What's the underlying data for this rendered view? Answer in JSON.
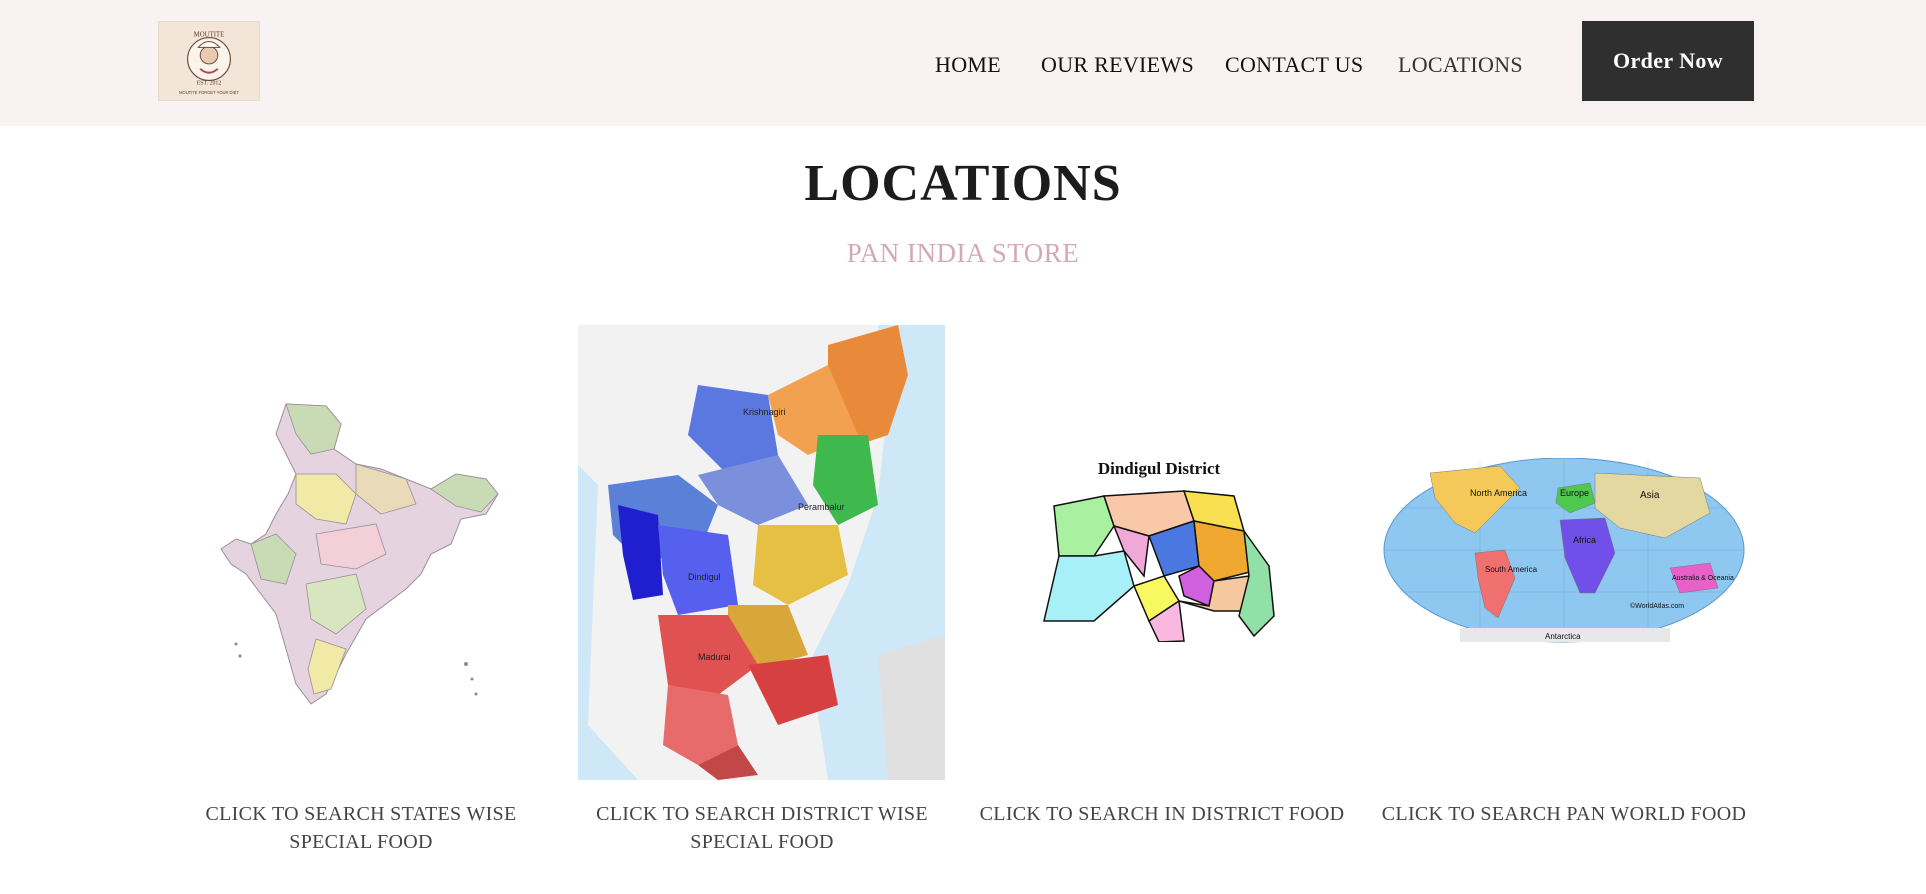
{
  "header": {
    "logo": {
      "lines": [
        "MOUTITE",
        "EST. 2012",
        "MOUTITE FORGET YOUR DIET"
      ]
    },
    "nav": [
      "HOME",
      "OUR REVIEWS",
      "CONTACT US",
      "LOCATIONS"
    ],
    "order_button": "Order Now"
  },
  "main": {
    "title": "LOCATIONS",
    "subtitle": "PAN INDIA STORE",
    "cards": [
      {
        "caption": "CLICK TO SEARCH STATES WISE SPECIAL FOOD"
      },
      {
        "caption": "CLICK TO SEARCH DISTRICT WISE SPECIAL FOOD"
      },
      {
        "caption": "CLICK TO SEARCH IN DISTRICT FOOD",
        "image_title": "Dindigul District"
      },
      {
        "caption": "CLICK TO SEARCH PAN WORLD FOOD",
        "image_labels": [
          "North America",
          "South America",
          "Europe",
          "Asia",
          "Africa",
          "Australia & Oceania",
          "Antarctica",
          "©WorldAtlas.com"
        ]
      }
    ]
  },
  "colors": {
    "header_bg": "#f8f3f2",
    "button_bg": "#2f2f2f",
    "subtitle": "#d3a9b9"
  }
}
